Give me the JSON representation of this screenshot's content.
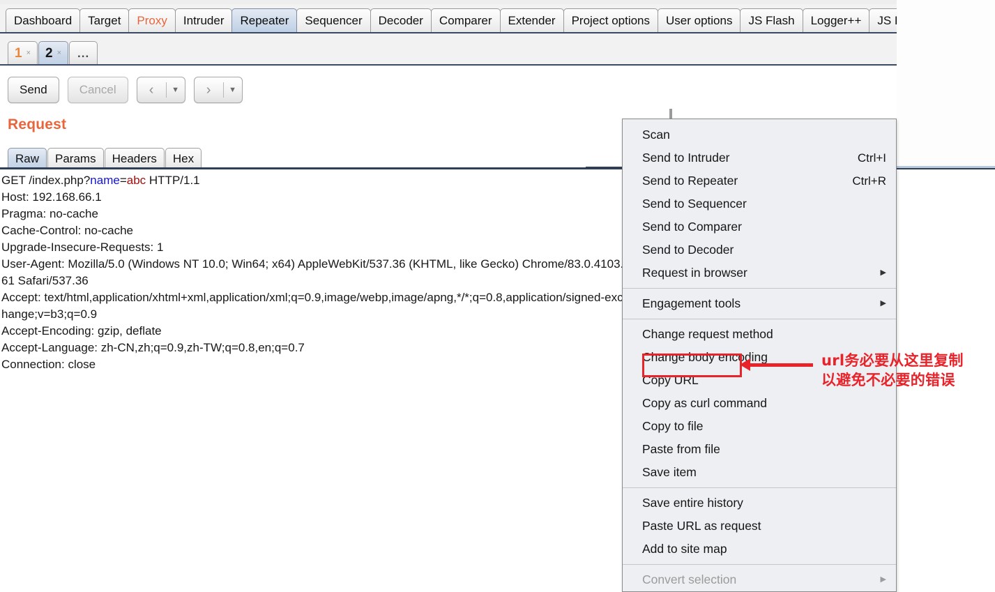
{
  "app": {
    "name": "Burp Suite Repeater"
  },
  "main_tabs": [
    {
      "label": "Dashboard",
      "state": "normal"
    },
    {
      "label": "Target",
      "state": "normal"
    },
    {
      "label": "Proxy",
      "state": "highlight"
    },
    {
      "label": "Intruder",
      "state": "normal"
    },
    {
      "label": "Repeater",
      "state": "selected"
    },
    {
      "label": "Sequencer",
      "state": "normal"
    },
    {
      "label": "Decoder",
      "state": "normal"
    },
    {
      "label": "Comparer",
      "state": "normal"
    },
    {
      "label": "Extender",
      "state": "normal"
    },
    {
      "label": "Project options",
      "state": "normal"
    },
    {
      "label": "User options",
      "state": "normal"
    },
    {
      "label": "JS Flash",
      "state": "normal"
    },
    {
      "label": "Logger++",
      "state": "normal"
    },
    {
      "label": "JS Rainbow",
      "state": "normal"
    }
  ],
  "sub_tabs": [
    {
      "label": "1",
      "close": "×",
      "state": "normal"
    },
    {
      "label": "2",
      "close": "×",
      "state": "selected"
    },
    {
      "label": "...",
      "close": "",
      "state": "overflow"
    }
  ],
  "toolbar": {
    "send_label": "Send",
    "cancel_label": "Cancel",
    "back_glyph": "‹",
    "forward_glyph": "›",
    "caret_glyph": "▼"
  },
  "request": {
    "section_title": "Request",
    "tabs": [
      {
        "label": "Raw",
        "state": "selected"
      },
      {
        "label": "Params",
        "state": "normal"
      },
      {
        "label": "Headers",
        "state": "normal"
      },
      {
        "label": "Hex",
        "state": "normal"
      }
    ],
    "raw_lines": [
      "GET /index.php?<k>name</k>=<v>abc</v> HTTP/1.1",
      "Host: 192.168.66.1",
      "Pragma: no-cache",
      "Cache-Control: no-cache",
      "Upgrade-Insecure-Requests: 1",
      "User-Agent: Mozilla/5.0 (Windows NT 10.0; Win64; x64) AppleWebKit/537.36 (KHTML, like Gecko) Chrome/83.0.4103.61 Safari/537.36",
      "Accept: text/html,application/xhtml+xml,application/xml;q=0.9,image/webp,image/apng,*/*;q=0.8,application/signed-exchange;v=b3;q=0.9",
      "Accept-Encoding: gzip, deflate",
      "Accept-Language: zh-CN,zh;q=0.9,zh-TW;q=0.8,en;q=0.7",
      "Connection: close"
    ],
    "param_key": "name",
    "param_value": "abc"
  },
  "context_menu": {
    "groups": [
      {
        "items": [
          {
            "label": "Scan",
            "accel": "",
            "submenu": false,
            "disabled": false
          },
          {
            "label": "Send to Intruder",
            "accel": "Ctrl+I",
            "submenu": false,
            "disabled": false
          },
          {
            "label": "Send to Repeater",
            "accel": "Ctrl+R",
            "submenu": false,
            "disabled": false
          },
          {
            "label": "Send to Sequencer",
            "accel": "",
            "submenu": false,
            "disabled": false
          },
          {
            "label": "Send to Comparer",
            "accel": "",
            "submenu": false,
            "disabled": false
          },
          {
            "label": "Send to Decoder",
            "accel": "",
            "submenu": false,
            "disabled": false
          },
          {
            "label": "Request in browser",
            "accel": "",
            "submenu": true,
            "disabled": false
          }
        ]
      },
      {
        "items": [
          {
            "label": "Engagement tools",
            "accel": "",
            "submenu": true,
            "disabled": false
          }
        ]
      },
      {
        "items": [
          {
            "label": "Change request method",
            "accel": "",
            "submenu": false,
            "disabled": false
          },
          {
            "label": "Change body encoding",
            "accel": "",
            "submenu": false,
            "disabled": false
          },
          {
            "label": "Copy URL",
            "accel": "",
            "submenu": false,
            "disabled": false,
            "highlighted": true
          },
          {
            "label": "Copy as curl command",
            "accel": "",
            "submenu": false,
            "disabled": false
          },
          {
            "label": "Copy to file",
            "accel": "",
            "submenu": false,
            "disabled": false
          },
          {
            "label": "Paste from file",
            "accel": "",
            "submenu": false,
            "disabled": false
          },
          {
            "label": "Save item",
            "accel": "",
            "submenu": false,
            "disabled": false
          }
        ]
      },
      {
        "items": [
          {
            "label": "Save entire history",
            "accel": "",
            "submenu": false,
            "disabled": false
          },
          {
            "label": "Paste URL as request",
            "accel": "",
            "submenu": false,
            "disabled": false
          },
          {
            "label": "Add to site map",
            "accel": "",
            "submenu": false,
            "disabled": false
          }
        ]
      },
      {
        "items": [
          {
            "label": "Convert selection",
            "accel": "",
            "submenu": true,
            "disabled": true
          }
        ]
      }
    ],
    "submenu_arrow": "▶"
  },
  "annotation": {
    "line1": "url务必要从这里复制",
    "line2": "以避免不必要的错误",
    "target_item": "Copy URL"
  },
  "colors": {
    "accent_orange": "#e8663d",
    "annotation_red": "#e8232a",
    "selected_tab_blue": "#ccd9ea",
    "param_key_blue": "#1414d2",
    "param_value_red": "#a01010",
    "menu_bg": "#edeff2"
  }
}
